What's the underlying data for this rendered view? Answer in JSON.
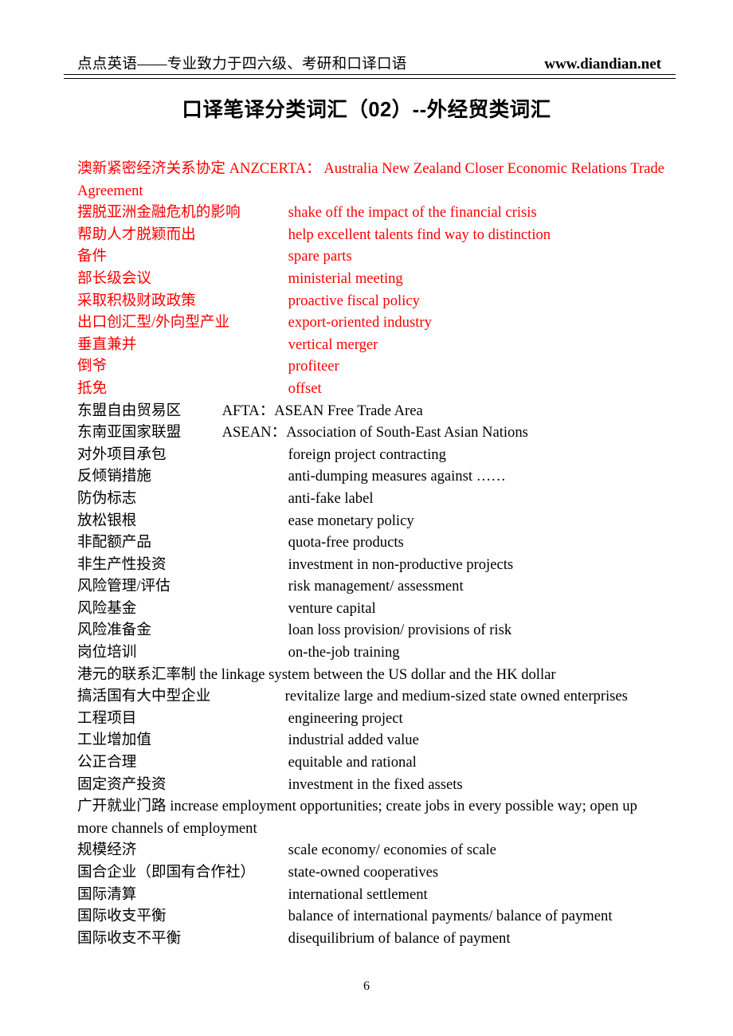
{
  "header": {
    "left_text": "点点英语——专业致力于四六级、考研和口译口语",
    "website": "www.diandian.net"
  },
  "title": "口译笔译分类词汇（02）--外经贸类词汇",
  "colors": {
    "highlight_red": "#ff0000",
    "body_text": "#000000",
    "page_background": "#ffffff"
  },
  "footer": {
    "page_number": "6"
  },
  "entries": [
    {
      "term": "澳新紧密经济关系协定 ANZCERTA：",
      "gloss": "Australia New Zealand Closer Economic Relations Trade Agreement",
      "color": "red",
      "layout": "wrap"
    },
    {
      "term": "摆脱亚洲金融危机的影响",
      "gloss": "shake off the impact of the financial crisis",
      "color": "red",
      "layout": "columns"
    },
    {
      "term": "帮助人才脱颖而出",
      "gloss": "help excellent talents find way to distinction",
      "color": "red",
      "layout": "columns"
    },
    {
      "term": "备件",
      "gloss": "spare parts",
      "color": "red",
      "layout": "columns"
    },
    {
      "term": "部长级会议",
      "gloss": "ministerial meeting",
      "color": "red",
      "layout": "columns"
    },
    {
      "term": "采取积极财政政策",
      "gloss": "proactive fiscal policy",
      "color": "red",
      "layout": "columns"
    },
    {
      "term": "出口创汇型/外向型产业",
      "gloss": "export-oriented industry",
      "color": "red",
      "layout": "columns"
    },
    {
      "term": "垂直兼并",
      "gloss": "vertical merger",
      "color": "red",
      "layout": "columns"
    },
    {
      "term": "倒爷",
      "gloss": "profiteer",
      "color": "red",
      "layout": "columns"
    },
    {
      "term": "抵免",
      "gloss": "offset",
      "color": "red",
      "layout": "columns"
    },
    {
      "term": "东盟自由贸易区",
      "gloss": "AFTA：ASEAN Free Trade Area",
      "color": "black",
      "layout": "columns-narrow"
    },
    {
      "term": "东南亚国家联盟",
      "gloss": "ASEAN：Association of South-East Asian Nations",
      "color": "black",
      "layout": "columns-narrow"
    },
    {
      "term": "对外项目承包",
      "gloss": "foreign project contracting",
      "color": "black",
      "layout": "columns"
    },
    {
      "term": "反倾销措施",
      "gloss": "anti-dumping measures against ……",
      "color": "black",
      "layout": "columns"
    },
    {
      "term": "防伪标志",
      "gloss": "anti-fake label",
      "color": "black",
      "layout": "columns"
    },
    {
      "term": "放松银根",
      "gloss": "ease monetary policy",
      "color": "black",
      "layout": "columns"
    },
    {
      "term": "非配额产品",
      "gloss": "quota-free products",
      "color": "black",
      "layout": "columns"
    },
    {
      "term": "非生产性投资",
      "gloss": "investment in non-productive projects",
      "color": "black",
      "layout": "columns"
    },
    {
      "term": "风险管理/评估",
      "gloss": "risk management/ assessment",
      "color": "black",
      "layout": "columns"
    },
    {
      "term": "风险基金",
      "gloss": "venture capital",
      "color": "black",
      "layout": "columns"
    },
    {
      "term": "风险准备金",
      "gloss": "loan loss provision/ provisions of risk",
      "color": "black",
      "layout": "columns"
    },
    {
      "term": "岗位培训",
      "gloss": "on-the-job training",
      "color": "black",
      "layout": "columns"
    },
    {
      "term": "港元的联系汇率制",
      "gloss": "the linkage system between the US dollar and the HK dollar",
      "color": "black",
      "layout": "inline"
    },
    {
      "term": "搞活国有大中型企业",
      "gloss": "revitalize large and medium-sized state owned enterprises",
      "color": "black",
      "layout": "columns-wide"
    },
    {
      "term": "工程项目",
      "gloss": "engineering project",
      "color": "black",
      "layout": "columns"
    },
    {
      "term": "工业增加值",
      "gloss": "industrial added value",
      "color": "black",
      "layout": "columns"
    },
    {
      "term": "公正合理",
      "gloss": "equitable and rational",
      "color": "black",
      "layout": "columns"
    },
    {
      "term": "固定资产投资",
      "gloss": "investment in the fixed assets",
      "color": "black",
      "layout": "columns"
    },
    {
      "term": "广开就业门路",
      "gloss": "increase employment opportunities; create jobs in every possible way; open up more channels of employment",
      "color": "black",
      "layout": "inline-wrap"
    },
    {
      "term": "规模经济",
      "gloss": "scale economy/ economies of scale",
      "color": "black",
      "layout": "columns"
    },
    {
      "term": "国合企业（即国有合作社）",
      "gloss": "state-owned cooperatives",
      "color": "black",
      "layout": "columns"
    },
    {
      "term": "国际清算",
      "gloss": "international settlement",
      "color": "black",
      "layout": "columns"
    },
    {
      "term": "国际收支平衡",
      "gloss": "balance of international payments/ balance of payment",
      "color": "black",
      "layout": "columns"
    },
    {
      "term": "国际收支不平衡",
      "gloss": "disequilibrium of balance of payment",
      "color": "black",
      "layout": "columns"
    }
  ]
}
